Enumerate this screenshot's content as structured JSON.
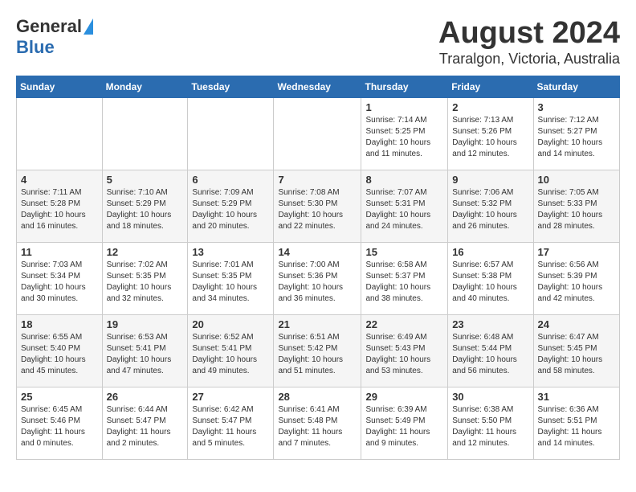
{
  "header": {
    "logo_general": "General",
    "logo_blue": "Blue",
    "main_title": "August 2024",
    "subtitle": "Traralgon, Victoria, Australia"
  },
  "calendar": {
    "days_of_week": [
      "Sunday",
      "Monday",
      "Tuesday",
      "Wednesday",
      "Thursday",
      "Friday",
      "Saturday"
    ],
    "weeks": [
      [
        {
          "day": "",
          "info": ""
        },
        {
          "day": "",
          "info": ""
        },
        {
          "day": "",
          "info": ""
        },
        {
          "day": "",
          "info": ""
        },
        {
          "day": "1",
          "info": "Sunrise: 7:14 AM\nSunset: 5:25 PM\nDaylight: 10 hours\nand 11 minutes."
        },
        {
          "day": "2",
          "info": "Sunrise: 7:13 AM\nSunset: 5:26 PM\nDaylight: 10 hours\nand 12 minutes."
        },
        {
          "day": "3",
          "info": "Sunrise: 7:12 AM\nSunset: 5:27 PM\nDaylight: 10 hours\nand 14 minutes."
        }
      ],
      [
        {
          "day": "4",
          "info": "Sunrise: 7:11 AM\nSunset: 5:28 PM\nDaylight: 10 hours\nand 16 minutes."
        },
        {
          "day": "5",
          "info": "Sunrise: 7:10 AM\nSunset: 5:29 PM\nDaylight: 10 hours\nand 18 minutes."
        },
        {
          "day": "6",
          "info": "Sunrise: 7:09 AM\nSunset: 5:29 PM\nDaylight: 10 hours\nand 20 minutes."
        },
        {
          "day": "7",
          "info": "Sunrise: 7:08 AM\nSunset: 5:30 PM\nDaylight: 10 hours\nand 22 minutes."
        },
        {
          "day": "8",
          "info": "Sunrise: 7:07 AM\nSunset: 5:31 PM\nDaylight: 10 hours\nand 24 minutes."
        },
        {
          "day": "9",
          "info": "Sunrise: 7:06 AM\nSunset: 5:32 PM\nDaylight: 10 hours\nand 26 minutes."
        },
        {
          "day": "10",
          "info": "Sunrise: 7:05 AM\nSunset: 5:33 PM\nDaylight: 10 hours\nand 28 minutes."
        }
      ],
      [
        {
          "day": "11",
          "info": "Sunrise: 7:03 AM\nSunset: 5:34 PM\nDaylight: 10 hours\nand 30 minutes."
        },
        {
          "day": "12",
          "info": "Sunrise: 7:02 AM\nSunset: 5:35 PM\nDaylight: 10 hours\nand 32 minutes."
        },
        {
          "day": "13",
          "info": "Sunrise: 7:01 AM\nSunset: 5:35 PM\nDaylight: 10 hours\nand 34 minutes."
        },
        {
          "day": "14",
          "info": "Sunrise: 7:00 AM\nSunset: 5:36 PM\nDaylight: 10 hours\nand 36 minutes."
        },
        {
          "day": "15",
          "info": "Sunrise: 6:58 AM\nSunset: 5:37 PM\nDaylight: 10 hours\nand 38 minutes."
        },
        {
          "day": "16",
          "info": "Sunrise: 6:57 AM\nSunset: 5:38 PM\nDaylight: 10 hours\nand 40 minutes."
        },
        {
          "day": "17",
          "info": "Sunrise: 6:56 AM\nSunset: 5:39 PM\nDaylight: 10 hours\nand 42 minutes."
        }
      ],
      [
        {
          "day": "18",
          "info": "Sunrise: 6:55 AM\nSunset: 5:40 PM\nDaylight: 10 hours\nand 45 minutes."
        },
        {
          "day": "19",
          "info": "Sunrise: 6:53 AM\nSunset: 5:41 PM\nDaylight: 10 hours\nand 47 minutes."
        },
        {
          "day": "20",
          "info": "Sunrise: 6:52 AM\nSunset: 5:41 PM\nDaylight: 10 hours\nand 49 minutes."
        },
        {
          "day": "21",
          "info": "Sunrise: 6:51 AM\nSunset: 5:42 PM\nDaylight: 10 hours\nand 51 minutes."
        },
        {
          "day": "22",
          "info": "Sunrise: 6:49 AM\nSunset: 5:43 PM\nDaylight: 10 hours\nand 53 minutes."
        },
        {
          "day": "23",
          "info": "Sunrise: 6:48 AM\nSunset: 5:44 PM\nDaylight: 10 hours\nand 56 minutes."
        },
        {
          "day": "24",
          "info": "Sunrise: 6:47 AM\nSunset: 5:45 PM\nDaylight: 10 hours\nand 58 minutes."
        }
      ],
      [
        {
          "day": "25",
          "info": "Sunrise: 6:45 AM\nSunset: 5:46 PM\nDaylight: 11 hours\nand 0 minutes."
        },
        {
          "day": "26",
          "info": "Sunrise: 6:44 AM\nSunset: 5:47 PM\nDaylight: 11 hours\nand 2 minutes."
        },
        {
          "day": "27",
          "info": "Sunrise: 6:42 AM\nSunset: 5:47 PM\nDaylight: 11 hours\nand 5 minutes."
        },
        {
          "day": "28",
          "info": "Sunrise: 6:41 AM\nSunset: 5:48 PM\nDaylight: 11 hours\nand 7 minutes."
        },
        {
          "day": "29",
          "info": "Sunrise: 6:39 AM\nSunset: 5:49 PM\nDaylight: 11 hours\nand 9 minutes."
        },
        {
          "day": "30",
          "info": "Sunrise: 6:38 AM\nSunset: 5:50 PM\nDaylight: 11 hours\nand 12 minutes."
        },
        {
          "day": "31",
          "info": "Sunrise: 6:36 AM\nSunset: 5:51 PM\nDaylight: 11 hours\nand 14 minutes."
        }
      ]
    ]
  }
}
